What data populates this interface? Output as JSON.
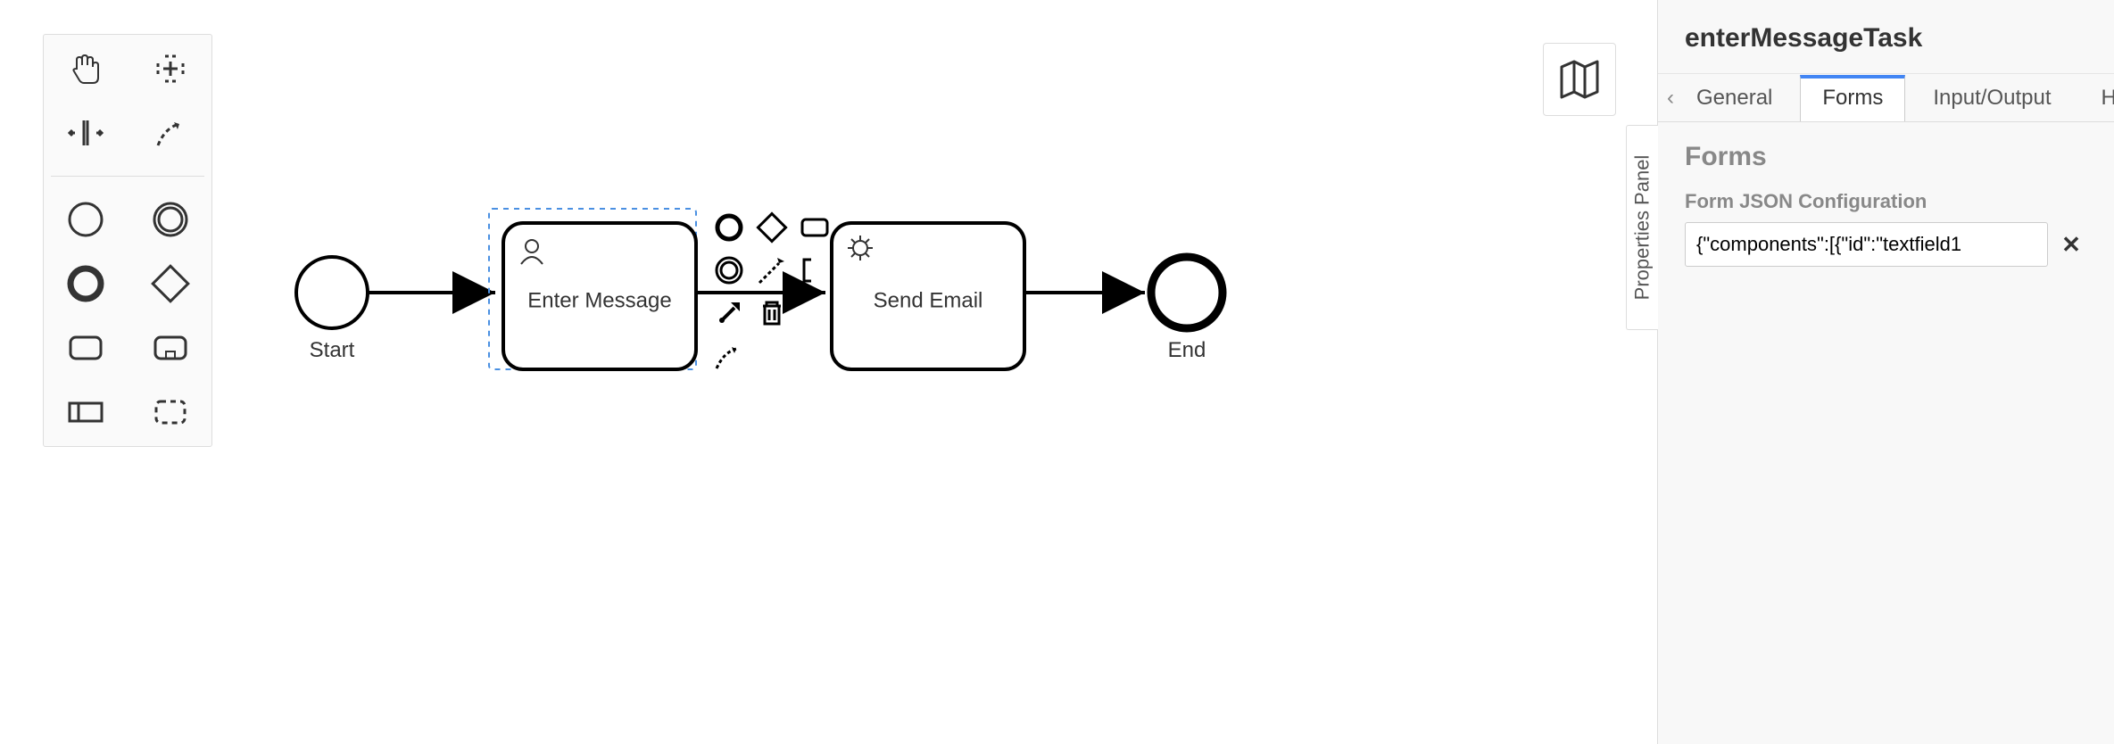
{
  "diagram": {
    "start": {
      "label": "Start"
    },
    "task1": {
      "label": "Enter Message",
      "selected": true
    },
    "task2": {
      "label": "Send Email"
    },
    "end": {
      "label": "End"
    }
  },
  "palette": {
    "tools": [
      "hand-tool",
      "lasso-tool",
      "space-tool",
      "global-connect-tool"
    ],
    "shapes": [
      "start-event",
      "intermediate-event",
      "end-event",
      "gateway",
      "task",
      "subprocess-expanded",
      "participant",
      "group"
    ]
  },
  "context_pad": [
    "append-end-event",
    "append-gateway",
    "append-task",
    "append-intermediate",
    "connect",
    "text-annotation",
    "wrench",
    "delete",
    "",
    "replace",
    "",
    ""
  ],
  "properties": {
    "toggle_label": "Properties Panel",
    "title": "enterMessageTask",
    "tabs": [
      {
        "id": "general",
        "label": "General",
        "active": false
      },
      {
        "id": "forms",
        "label": "Forms",
        "active": true
      },
      {
        "id": "io",
        "label": "Input/Output",
        "active": false
      },
      {
        "id": "history",
        "label": "H",
        "active": false
      }
    ],
    "group_title": "Forms",
    "field_label": "Form JSON Configuration",
    "field_value": "{\"components\":[{\"id\":\"textfield1"
  },
  "minimap": {
    "tooltip": "Toggle minimap"
  }
}
